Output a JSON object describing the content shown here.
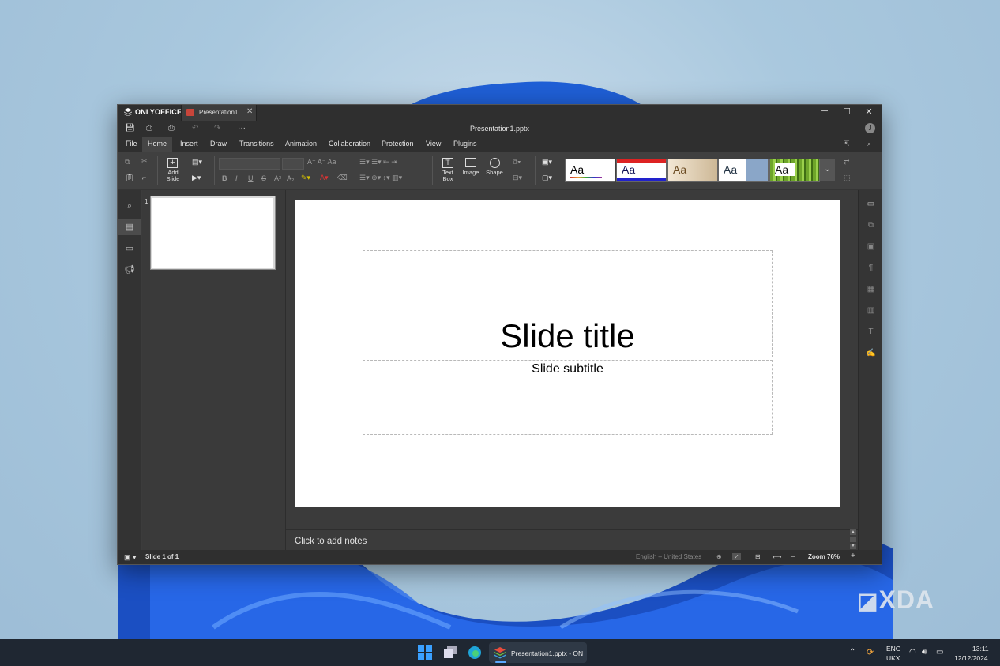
{
  "app": {
    "brand": "ONLYOFFICE",
    "tab_label": "Presentation1....",
    "doc_title": "Presentation1.pptx",
    "user_initial": "J"
  },
  "menu": [
    {
      "label": "File"
    },
    {
      "label": "Home",
      "active": true
    },
    {
      "label": "Insert"
    },
    {
      "label": "Draw"
    },
    {
      "label": "Transitions"
    },
    {
      "label": "Animation"
    },
    {
      "label": "Collaboration"
    },
    {
      "label": "Protection"
    },
    {
      "label": "View"
    },
    {
      "label": "Plugins"
    }
  ],
  "ribbon": {
    "add_slide": "Add\nSlide",
    "text_box": "Text\nBox",
    "image": "Image",
    "shape": "Shape",
    "theme_sample": "Aa",
    "accent_colors": {
      "primary": "#c8453a",
      "window_bg": "#2a2a2a",
      "ribbon_bg": "#404040"
    }
  },
  "slides_panel": {
    "slide_number": "1"
  },
  "slide": {
    "title": "Slide title",
    "subtitle": "Slide subtitle"
  },
  "notes": {
    "placeholder": "Click to add notes"
  },
  "status": {
    "slide_counter": "Slide 1 of 1",
    "language": "English – United States",
    "zoom": "Zoom 76%"
  },
  "taskbar": {
    "app_label": "Presentation1.pptx - ON",
    "lang": "ENG",
    "layout": "UKX",
    "time": "13:11",
    "date": "12/12/2024"
  },
  "watermark": "XDA"
}
